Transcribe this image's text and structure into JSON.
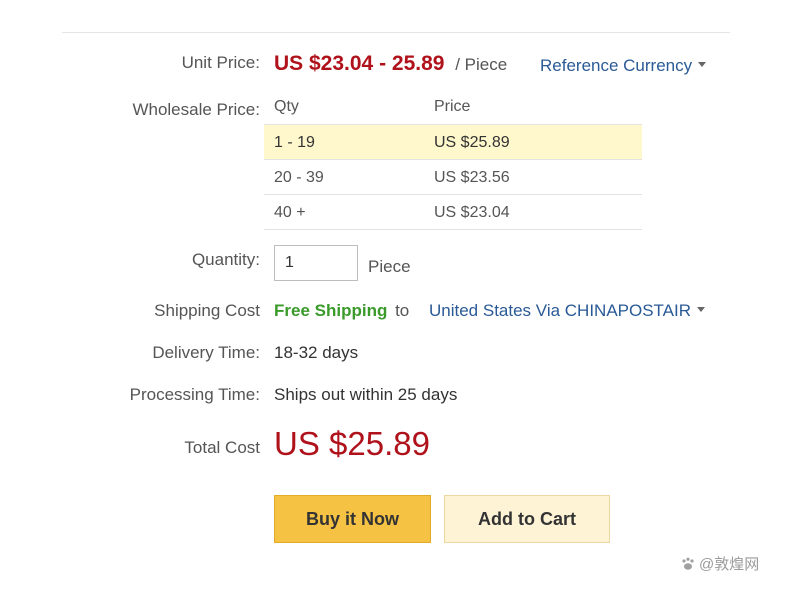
{
  "unit_price": {
    "label": "Unit Price:",
    "range": "US $23.04 - 25.89",
    "per": "/ Piece",
    "currency_link": "Reference Currency"
  },
  "wholesale": {
    "label": "Wholesale Price:",
    "headers": {
      "qty": "Qty",
      "price": "Price"
    },
    "rows": [
      {
        "qty": "1 - 19",
        "price": "US $25.89",
        "highlighted": true
      },
      {
        "qty": "20 - 39",
        "price": "US $23.56",
        "highlighted": false
      },
      {
        "qty": "40 +",
        "price": "US $23.04",
        "highlighted": false
      }
    ]
  },
  "quantity": {
    "label": "Quantity:",
    "value": "1",
    "unit": "Piece"
  },
  "shipping": {
    "label": "Shipping Cost",
    "free": "Free Shipping",
    "to": "to",
    "destination": "United States Via CHINAPOSTAIR"
  },
  "delivery": {
    "label": "Delivery Time:",
    "value": "18-32 days"
  },
  "processing": {
    "label": "Processing Time:",
    "value": "Ships out within 25 days"
  },
  "total": {
    "label": "Total Cost",
    "value": "US $25.89"
  },
  "buttons": {
    "buy_now": "Buy it Now",
    "add_to_cart": "Add to Cart"
  },
  "watermark": {
    "text": "@敦煌网"
  },
  "colors": {
    "price_red": "#b0121b",
    "link_blue": "#2a5a96",
    "free_green": "#3a9a2a",
    "buy_button": "#f5c243",
    "cart_button": "#fff3d6",
    "highlight_row": "#fff8cc"
  }
}
